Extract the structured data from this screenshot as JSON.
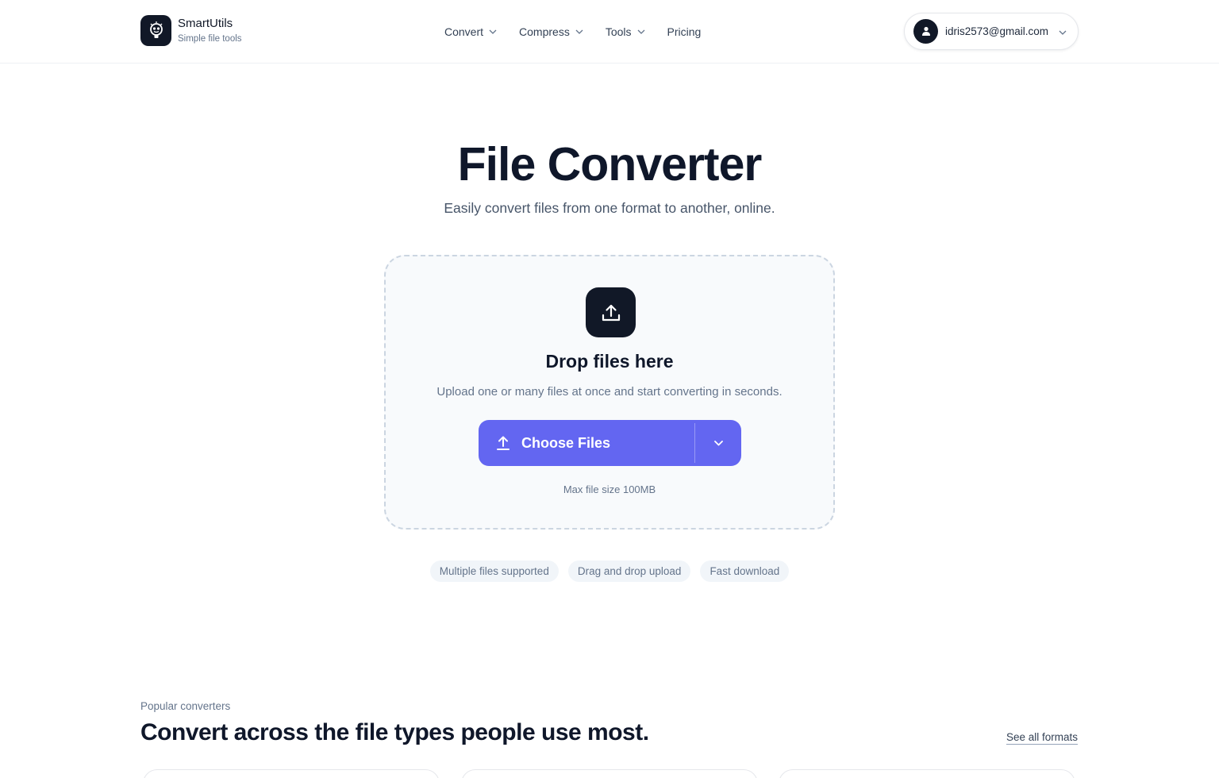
{
  "brand": {
    "name": "SmartUtils",
    "tagline": "Simple file tools"
  },
  "nav": {
    "items": [
      {
        "label": "Convert",
        "has_menu": true
      },
      {
        "label": "Compress",
        "has_menu": true
      },
      {
        "label": "Tools",
        "has_menu": true
      },
      {
        "label": "Pricing",
        "has_menu": false
      }
    ]
  },
  "account": {
    "email": "idris2573@gmail.com",
    "icon": "user-icon"
  },
  "hero": {
    "title": "File Converter",
    "subtitle": "Easily convert files from one format to another, online."
  },
  "dropzone": {
    "icon": "upload-icon",
    "title": "Drop files here",
    "subtitle": "Upload one or many files at once and start converting in seconds.",
    "button_label": "Choose Files",
    "max_size": "Max file size 100MB"
  },
  "features": [
    "Multiple files supported",
    "Drag and drop upload",
    "Fast download"
  ],
  "popular": {
    "kicker": "Popular converters",
    "title": "Convert across the file types people use most.",
    "see_all": "See all formats"
  },
  "colors": {
    "accent": "#6366f1",
    "dark": "#111827",
    "muted": "#64748b"
  }
}
